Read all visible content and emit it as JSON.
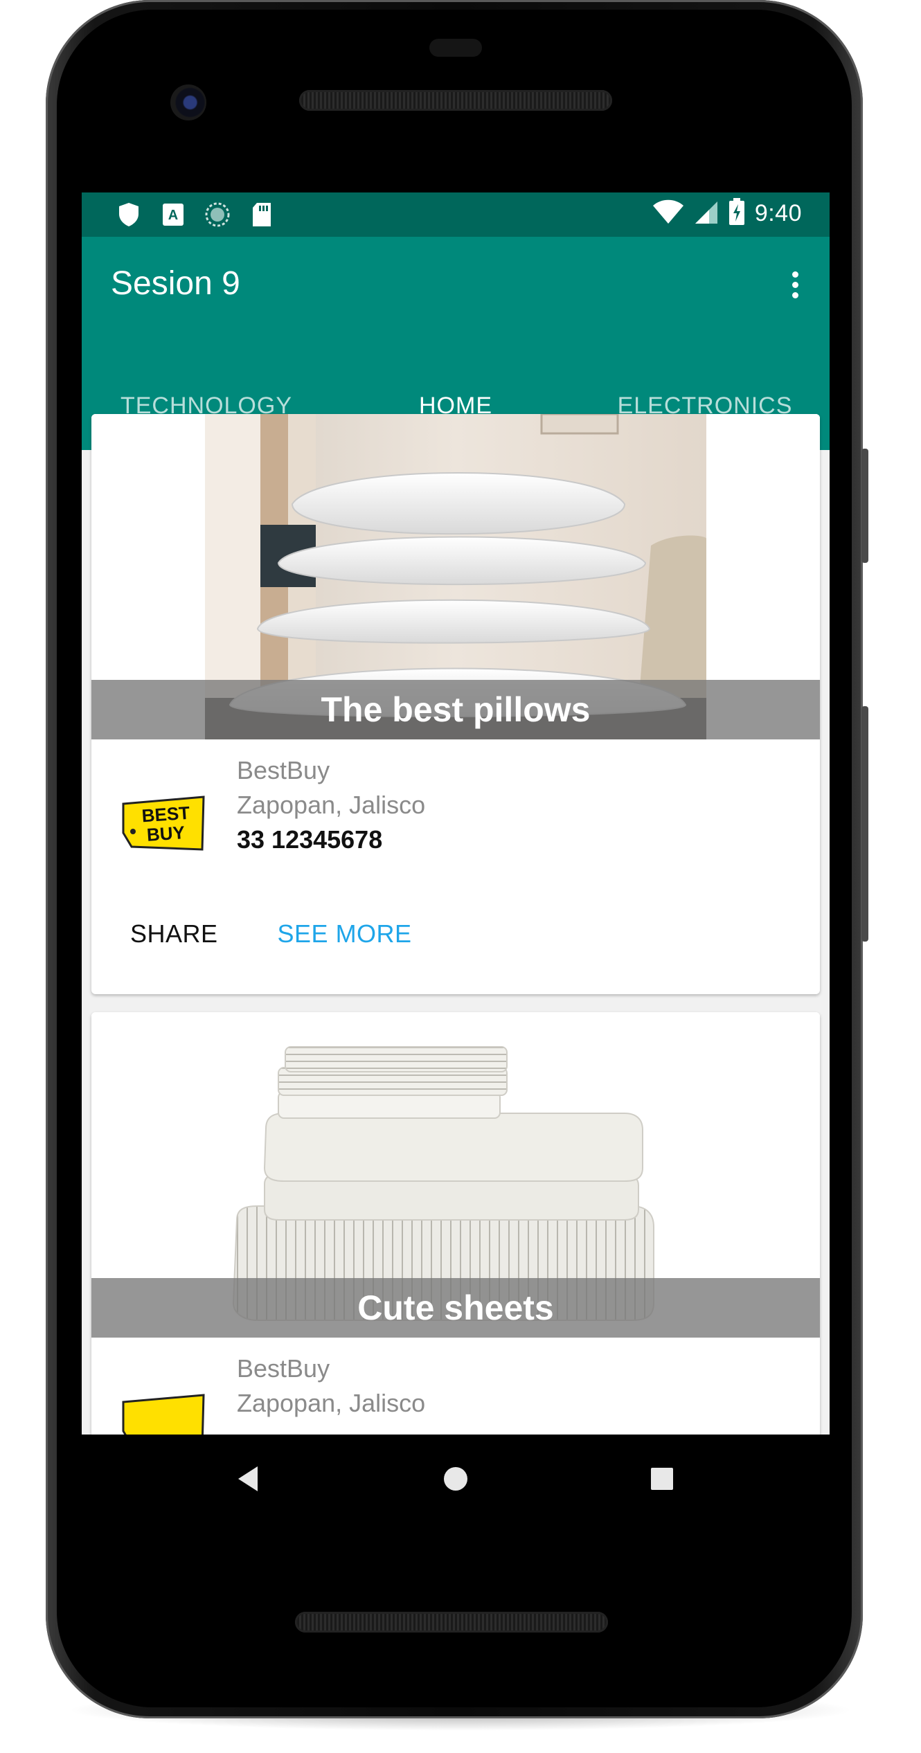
{
  "status_bar": {
    "time": "9:40",
    "left_icons": [
      "shield-icon",
      "a-box-icon",
      "sync-circle-icon",
      "sd-card-icon"
    ],
    "right_icons": [
      "wifi-icon",
      "signal-icon",
      "battery-charging-icon"
    ]
  },
  "app_bar": {
    "title": "Sesion 9",
    "overflow_icon": "more-vert-icon"
  },
  "tabs": [
    {
      "label": "TECHNOLOGY",
      "active": false
    },
    {
      "label": "HOME",
      "active": true
    },
    {
      "label": "ELECTRONICS",
      "active": false
    }
  ],
  "colors": {
    "status_bar": "#00675b",
    "app_bar": "#00897b",
    "tab_indicator": "#e91e63",
    "link": "#1ea5e9"
  },
  "cards": [
    {
      "caption": "The best pillows",
      "store": "BestBuy",
      "location": "Zapopan, Jalisco",
      "phone": "33 12345678",
      "logo_text": "BEST BUY",
      "share_label": "SHARE",
      "see_more_label": "SEE MORE"
    },
    {
      "caption": "Cute sheets",
      "store": "BestBuy",
      "location": "Zapopan, Jalisco"
    }
  ],
  "nav_bar": {
    "icons": [
      "back-icon",
      "home-icon",
      "recents-icon"
    ]
  }
}
